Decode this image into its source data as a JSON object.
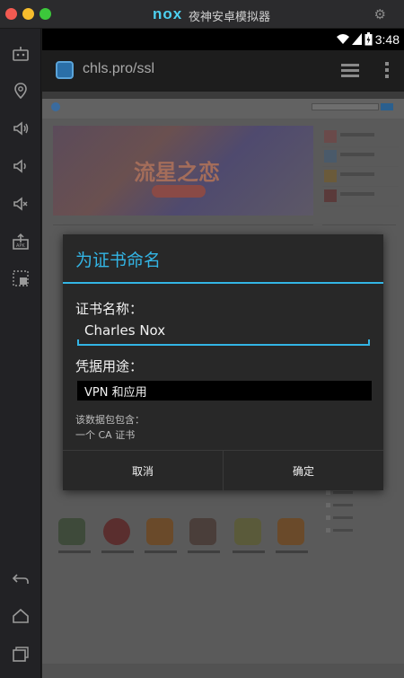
{
  "window": {
    "brand": "nox",
    "title": "夜神安卓模拟器"
  },
  "statusbar": {
    "time": "3:48"
  },
  "actionbar": {
    "url": "chls.pro/ssl"
  },
  "banner": {
    "headline": "流星之恋"
  },
  "dialog": {
    "title": "为证书命名",
    "name_label": "证书名称：",
    "name_value": "Charles Nox",
    "usage_label": "凭据用途：",
    "usage_value": "VPN 和应用",
    "info_line1": "该数据包包含：",
    "info_line2": "一个 CA 证书",
    "cancel_label": "取消",
    "ok_label": "确定"
  },
  "colors": {
    "accent": "#33b5e5",
    "dialog_bg": "#282828"
  },
  "icons": {
    "sidebar": [
      "robot-icon",
      "location-icon",
      "volume-up-icon",
      "volume-down-icon",
      "mute-icon",
      "apk-install-icon",
      "screenshot-icon",
      "back-icon",
      "home-icon",
      "recents-icon"
    ]
  }
}
